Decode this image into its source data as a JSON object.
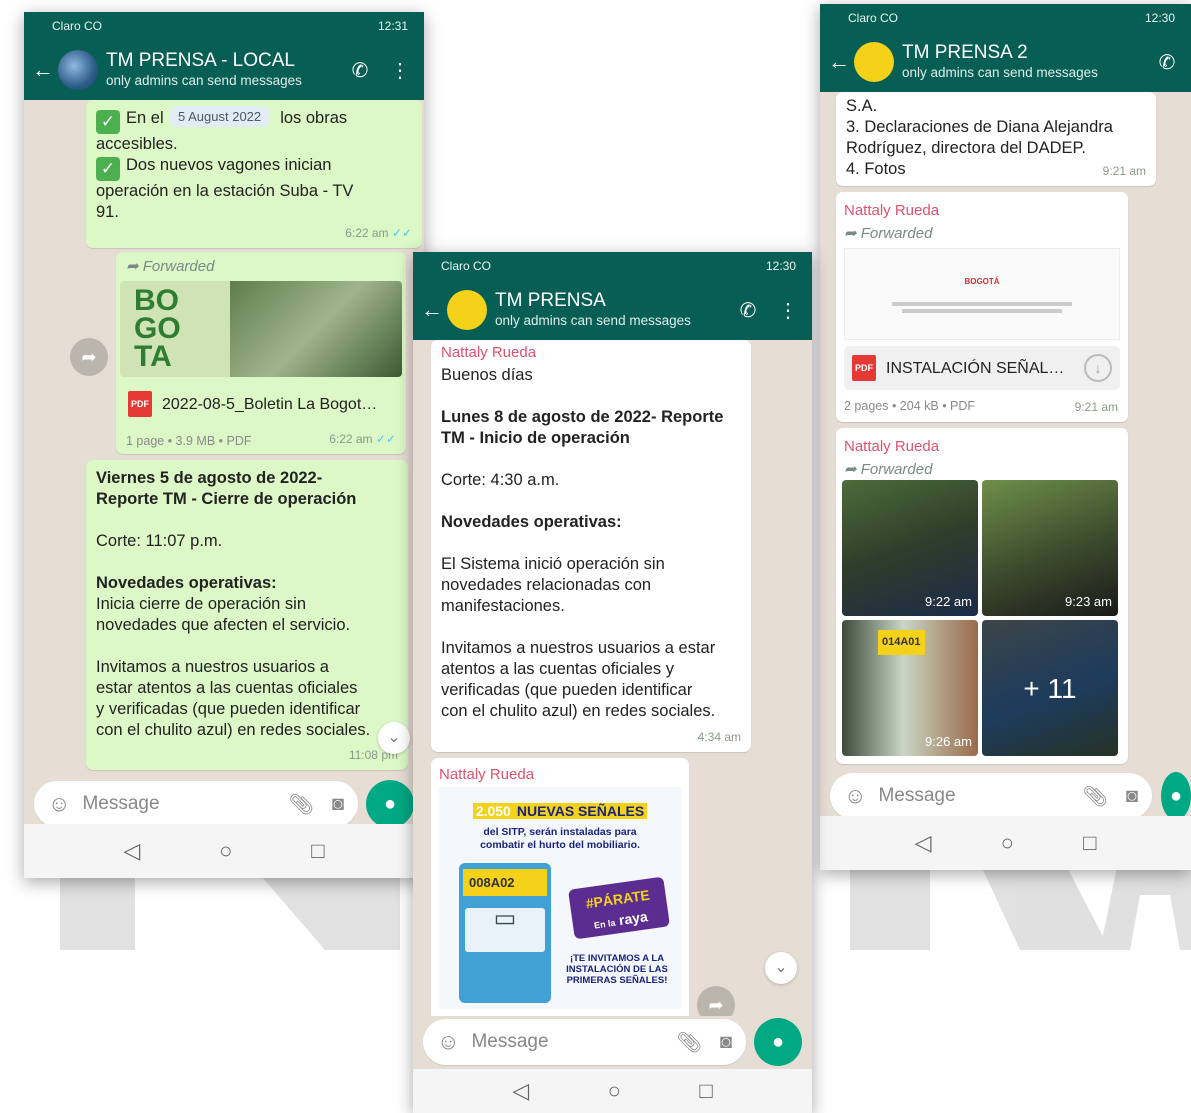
{
  "phones": {
    "p1": {
      "status": {
        "carrier": "Claro CO",
        "time": "12:31"
      },
      "header": {
        "title": "TM PRENSA - LOCAL",
        "subtitle": "only admins can send messages"
      },
      "date_chip": "5 August 2022",
      "msg1": {
        "line_a": "En el",
        "line_a_tail": "los obras",
        "line_b": "accesibles.",
        "line_c": "Dos nuevos vagones inician",
        "line_d": "operación en la estación Suba - TV",
        "line_e": "91.",
        "time": "6:22 am"
      },
      "doc_msg": {
        "forwarded": "Forwarded",
        "name": "2022-08-5_Boletin La Bogot…",
        "meta": "1 page • 3.9 MB • PDF",
        "time": "6:22 am"
      },
      "report": {
        "title1": "Viernes 5 de agosto de 2022-",
        "title2": "Reporte TM - Cierre de operación",
        "corte": "Corte: 11:07 p.m.",
        "nov_title": "Novedades operativas:",
        "nov_text1": "Inicia cierre de operación sin",
        "nov_text2": "novedades que afecten el servicio.",
        "inv1": "Invitamos a nuestros usuarios a",
        "inv2": "estar atentos a las cuentas oficiales",
        "inv3": "y verificadas (que pueden identificar",
        "inv4": "con el chulito azul) en redes sociales.",
        "time": "11:08 pm"
      },
      "composer_placeholder": "Message"
    },
    "p2": {
      "status": {
        "carrier": "Claro CO",
        "time": "12:30"
      },
      "header": {
        "title": "TM PRENSA",
        "subtitle": "only admins can send messages"
      },
      "msg": {
        "sender": "Nattaly Rueda",
        "greet": "Buenos días",
        "title1": "Lunes 8 de agosto de 2022-  Reporte",
        "title2": "TM - Inicio de operación",
        "corte": "Corte: 4:30 a.m.",
        "nov_title": "Novedades operativas:",
        "nov1": "El Sistema inició operación sin",
        "nov2": "novedades relacionadas con",
        "nov3": "manifestaciones.",
        "inv1": "Invitamos a nuestros usuarios a estar",
        "inv2": "atentos a las cuentas oficiales y",
        "inv3": "verificadas (que pueden identificar",
        "inv4": "con el chulito azul) en redes sociales.",
        "time": "4:34 am"
      },
      "img_msg": {
        "sender": "Nattaly Rueda",
        "poster_count": "2.050",
        "poster_headline": "NUEVAS SEÑALES",
        "poster_sub1": "del SITP, serán instaladas para",
        "poster_sub2": "combatir el hurto del mobiliario.",
        "stop_code": "008A02",
        "badge1": "#PÁRATE",
        "badge2": "raya",
        "badge_pre": "En la",
        "invite1": "¡TE INVITAMOS A LA",
        "invite2": "INSTALACIÓN DE LAS",
        "invite3": "PRIMERAS SEÑALES!"
      },
      "composer_placeholder": "Message"
    },
    "p3": {
      "status": {
        "carrier": "Claro CO",
        "time": "12:30"
      },
      "header": {
        "title": "TM PRENSA 2",
        "subtitle": "only admins can send messages"
      },
      "msg1": {
        "l1": "S.A.",
        "l2": "3. Declaraciones de Diana Alejandra",
        "l3": "Rodríguez, directora del DADEP.",
        "l4": "4. Fotos",
        "time": "9:21 am"
      },
      "doc_msg": {
        "sender": "Nattaly Rueda",
        "forwarded": "Forwarded",
        "preview_logo": "BOGOTÁ",
        "name": "INSTALACIÓN SEÑAL…",
        "meta": "2 pages • 204 kB • PDF",
        "time": "9:21 am"
      },
      "photos_msg": {
        "sender": "Nattaly Rueda",
        "forwarded": "Forwarded",
        "t1": "9:22 am",
        "t2": "9:23 am",
        "t3": "9:26 am",
        "stop_code": "014A01",
        "more": "+ 11"
      },
      "composer_placeholder": "Message"
    }
  },
  "watermark": "NTRA"
}
